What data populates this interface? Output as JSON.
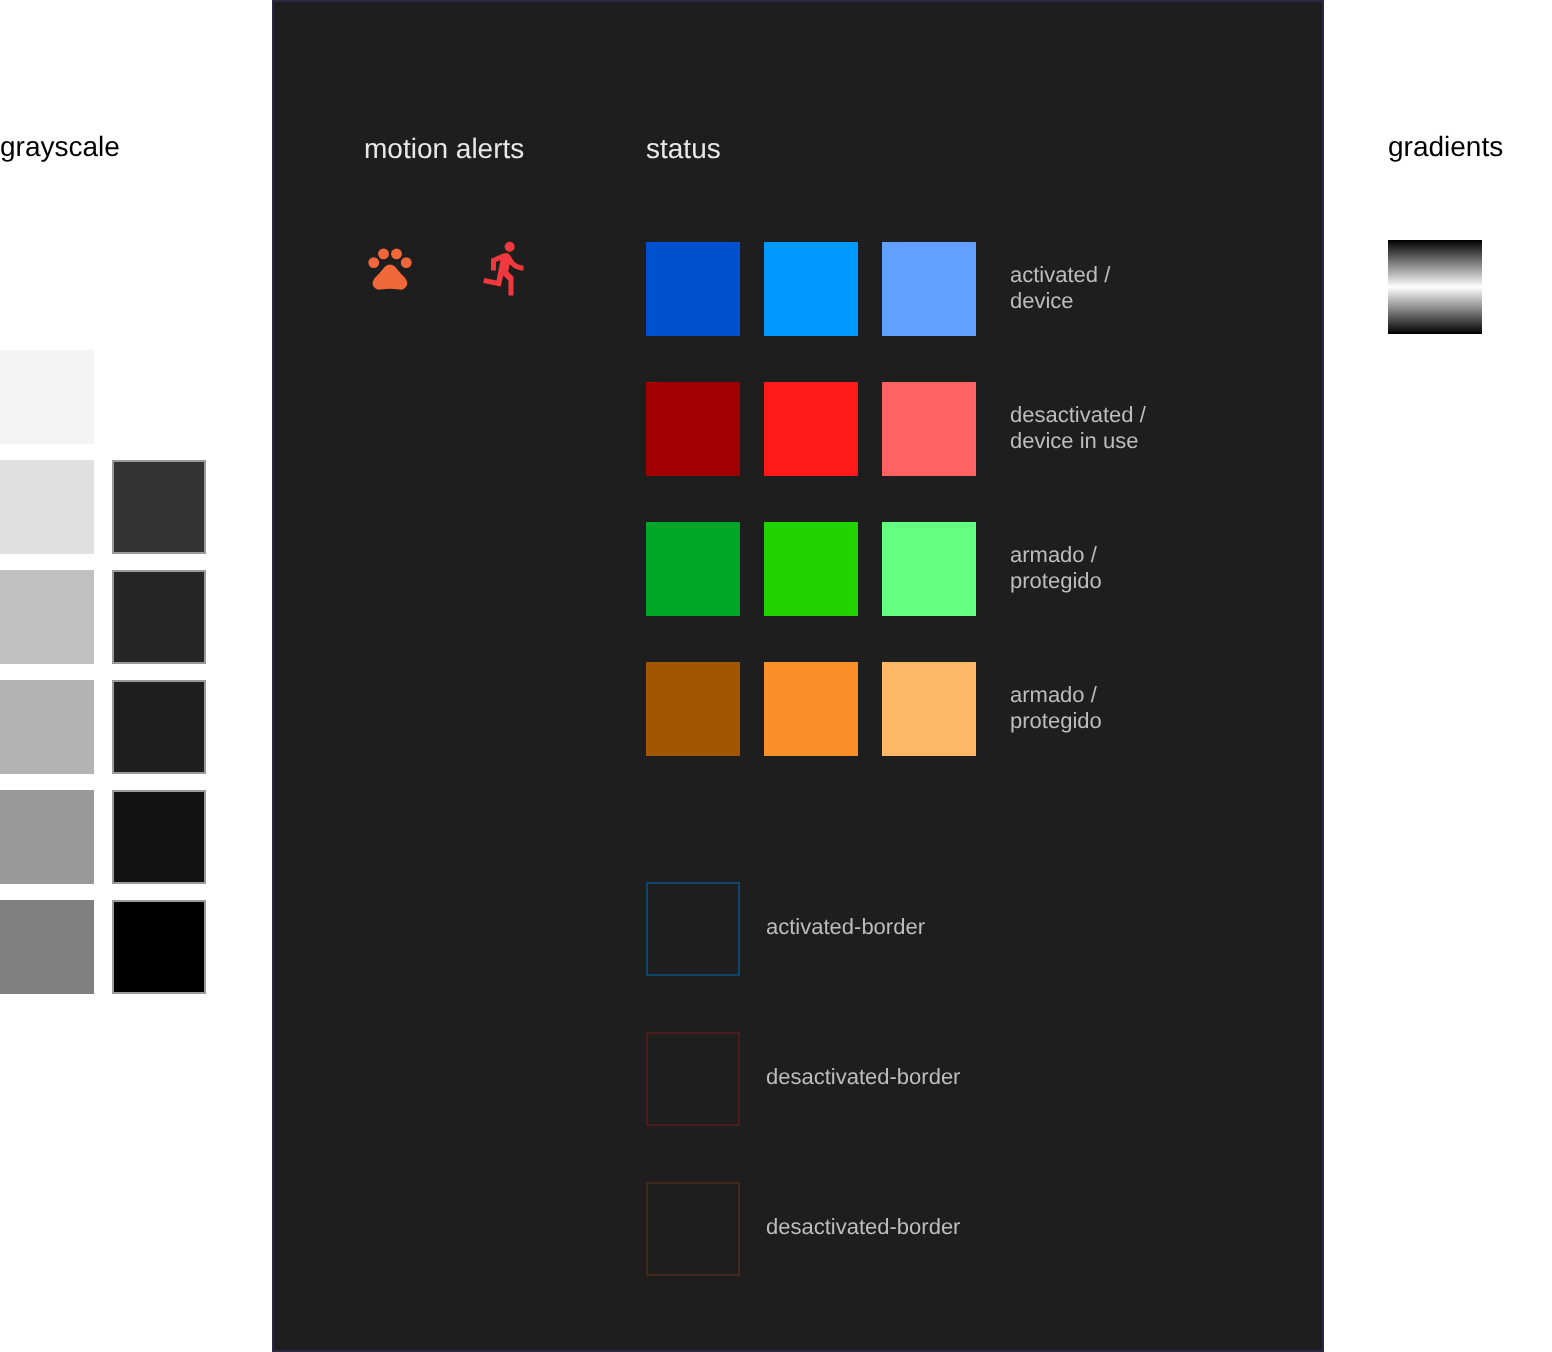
{
  "grayscale": {
    "title": "grayscale",
    "light": [
      {
        "color": "#f4f4f4"
      },
      {
        "color": "#e0e0e0"
      },
      {
        "color": "#c0c0c0"
      },
      {
        "color": "#b3b3b3"
      },
      {
        "color": "#999999"
      },
      {
        "color": "#808080"
      }
    ],
    "dark": [
      {
        "color": "#333333"
      },
      {
        "color": "#262626"
      },
      {
        "color": "#1f1f1f"
      },
      {
        "color": "#121212"
      },
      {
        "color": "#000000"
      }
    ]
  },
  "motion_alerts": {
    "title": "motion alerts",
    "icons": [
      {
        "kind": "paw",
        "color": "#f0673a"
      },
      {
        "kind": "runner",
        "color": "#f0383f"
      }
    ]
  },
  "status": {
    "title": "status",
    "rows": [
      {
        "label": "activated /\ndevice",
        "swatches": [
          {
            "color": "#0050cf"
          },
          {
            "color": "#0099ff"
          },
          {
            "color": "#62a0ff"
          }
        ]
      },
      {
        "label": "desactivated /\ndevice in use",
        "swatches": [
          {
            "color": "#a00000"
          },
          {
            "color": "#ff1a1a"
          },
          {
            "color": "#ff6262"
          }
        ]
      },
      {
        "label": "armado /\nprotegido",
        "swatches": [
          {
            "color": "#00a628"
          },
          {
            "color": "#21d400"
          },
          {
            "color": "#62ff80"
          }
        ]
      },
      {
        "label": "armado /\nprotegido",
        "swatches": [
          {
            "color": "#a35600"
          },
          {
            "color": "#f98f29"
          },
          {
            "color": "#ffb865"
          }
        ]
      }
    ],
    "borders": [
      {
        "label": "activated-border",
        "color": "#0c466a"
      },
      {
        "label": "desactivated-border",
        "color": "#4a1c1c"
      },
      {
        "label": "desactivated-border",
        "color": "#3f2a1d"
      }
    ]
  },
  "gradients": {
    "title": "gradients"
  }
}
